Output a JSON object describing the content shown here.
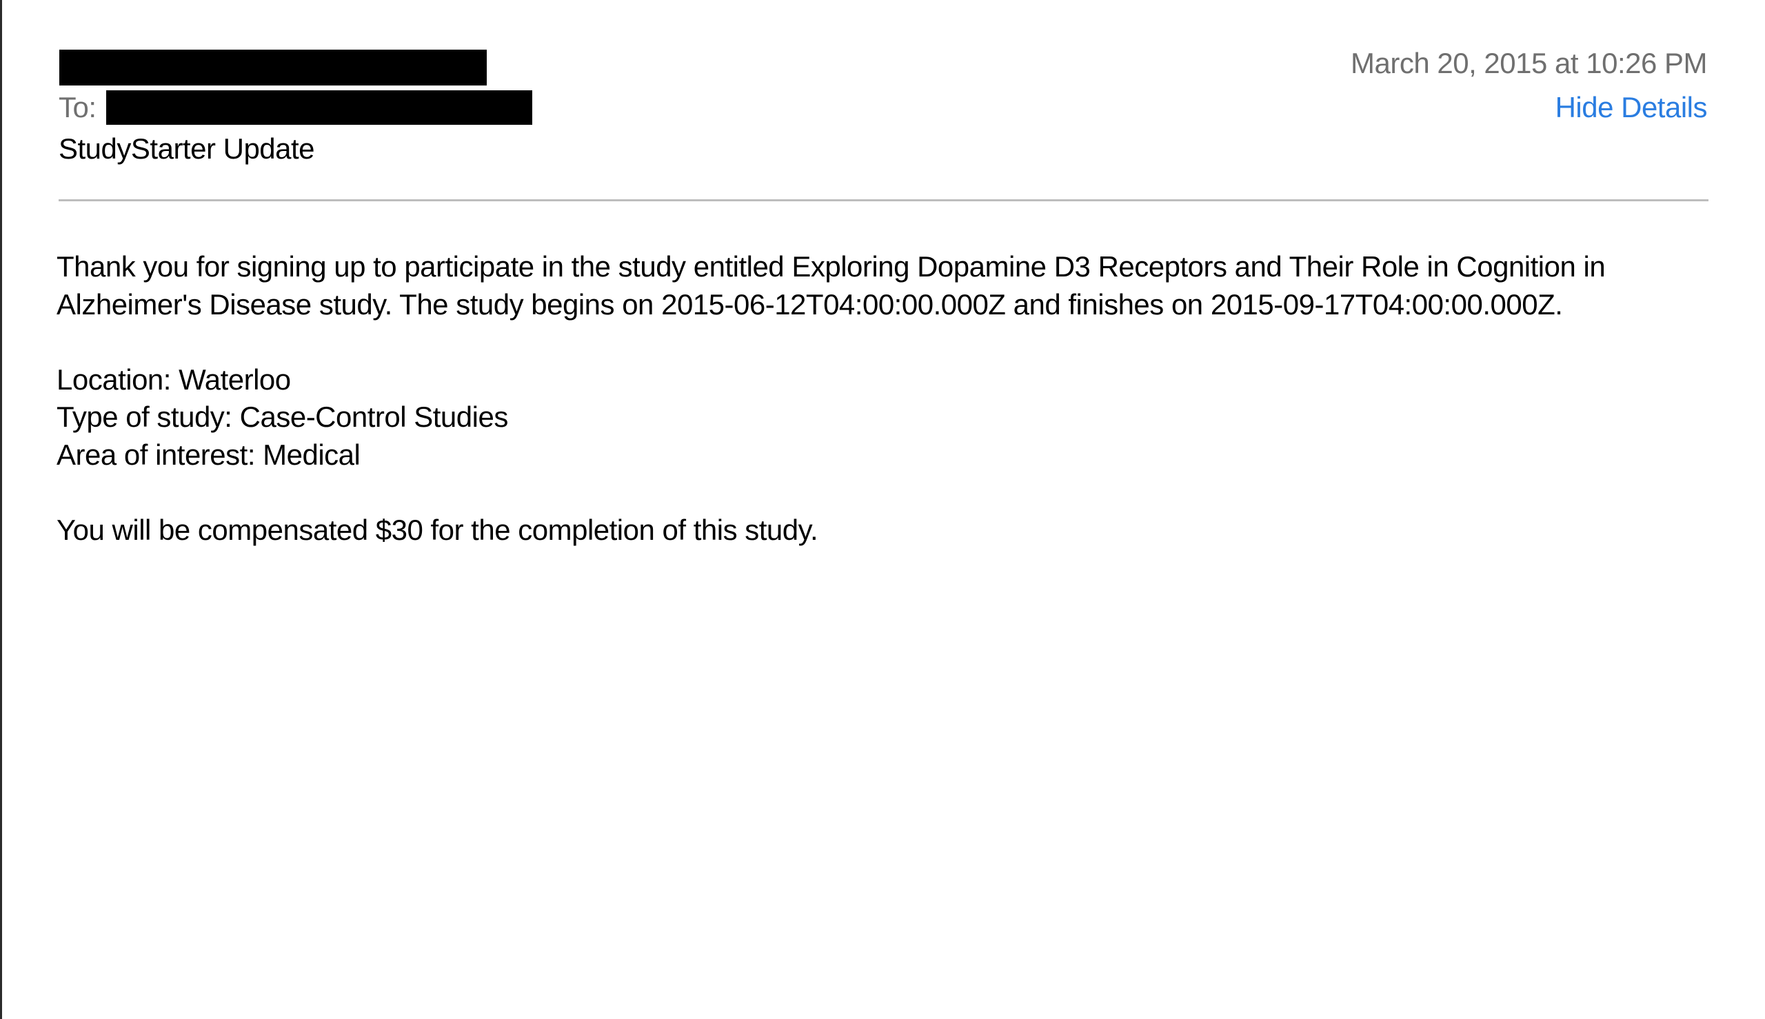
{
  "header": {
    "to_label": "To:",
    "subject": "StudyStarter Update",
    "date": "March 20, 2015 at 10:26 PM",
    "hide_details_label": "Hide Details"
  },
  "message": {
    "intro_line_1": "Thank you for signing up to participate in the study entitled Exploring Dopamine D3 Receptors and Their Role in Cognition in",
    "intro_line_2": "Alzheimer's Disease study. The study begins on 2015-06-12T04:00:00.000Z and finishes on 2015-09-17T04:00:00.000Z.",
    "location": "Location: Waterloo",
    "study_type": "Type of study: Case-Control Studies",
    "area_of_interest": "Area of interest: Medical",
    "compensation": "You will be compensated $30 for the completion of this study."
  },
  "colors": {
    "link": "#2a7de1",
    "meta_text": "#6f6f6f",
    "divider": "#bdbdbd",
    "redaction": "#000000"
  }
}
